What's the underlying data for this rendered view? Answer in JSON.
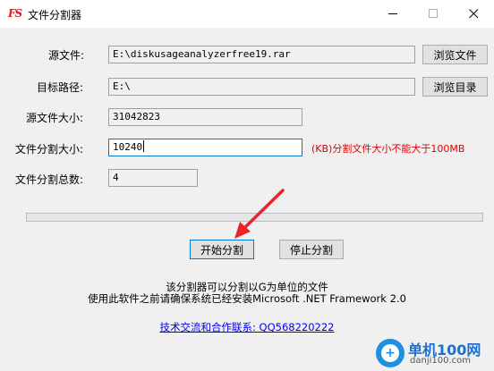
{
  "window": {
    "app_icon_text": "FS",
    "title": "文件分割器"
  },
  "form": {
    "source_file": {
      "label": "源文件:",
      "value": "E:\\diskusageanalyzerfree19.rar",
      "button": "浏览文件"
    },
    "target_path": {
      "label": "目标路径:",
      "value": "E:\\",
      "button": "浏览目录"
    },
    "source_size": {
      "label": "源文件大小:",
      "value": "31042823"
    },
    "split_size": {
      "label": "文件分割大小:",
      "value": "10240",
      "hint": "(KB)分割文件大小不能大于100MB"
    },
    "split_count": {
      "label": "文件分割总数:",
      "value": "4"
    }
  },
  "progress": {
    "value": 0
  },
  "actions": {
    "start": "开始分割",
    "stop": "停止分割"
  },
  "info": {
    "line1": "该分割器可以分割以G为单位的文件",
    "line2": "使用此软件之前请确保系统已经安装Microsoft .NET Framework 2.0",
    "link": "技术交流和合作联系: QQ568220222"
  },
  "watermark": {
    "title": "单机100网",
    "subtitle": "danji100.com"
  }
}
